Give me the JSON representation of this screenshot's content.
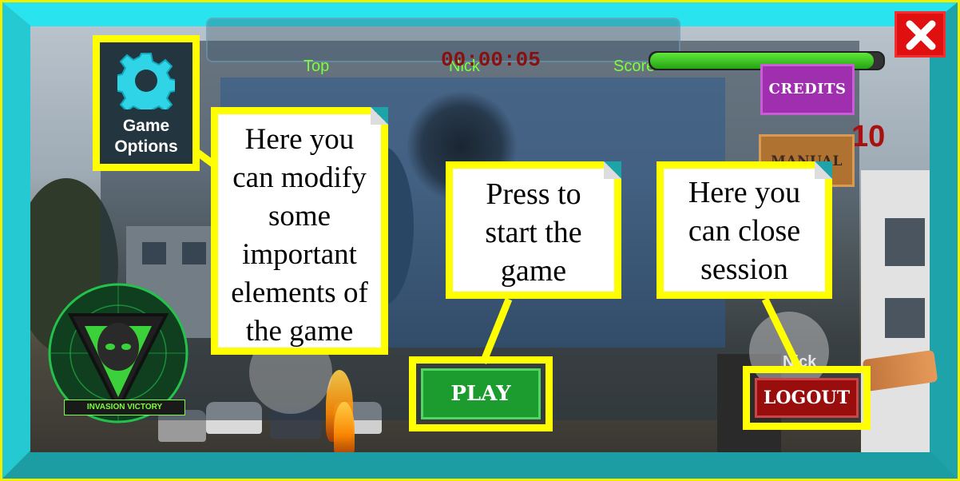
{
  "hud": {
    "top_label": "Top",
    "nick_label": "Nick",
    "score_label": "Score",
    "timer": "00:00:05",
    "score_value": "10",
    "health_fraction": 0.96
  },
  "menu": {
    "credits_label": "CREDITS",
    "manual_label": "MANUAL"
  },
  "game_options": {
    "label": "Game\nOptions",
    "icon": "gear-icon"
  },
  "callouts": {
    "options": "Here you\ncan modify\nsome\nimportant\nelements of\nthe game",
    "play": "Press to\nstart the\ngame",
    "logout": "Here you\ncan close\nsession"
  },
  "buttons": {
    "play_label": "PLAY",
    "logout_label": "LOGOUT",
    "close_icon": "close-icon"
  },
  "player": {
    "avatar_name": "Nick"
  },
  "logo": {
    "text": "INVASION VICTORY"
  },
  "colors": {
    "frame": "#1ea3a8",
    "highlight": "#ffff00",
    "hud_text": "#7cff3a",
    "play": "#1c9c2e",
    "logout": "#9a0d0d",
    "close": "#e01010",
    "credits": "#a02fb0",
    "manual": "#b07230"
  }
}
